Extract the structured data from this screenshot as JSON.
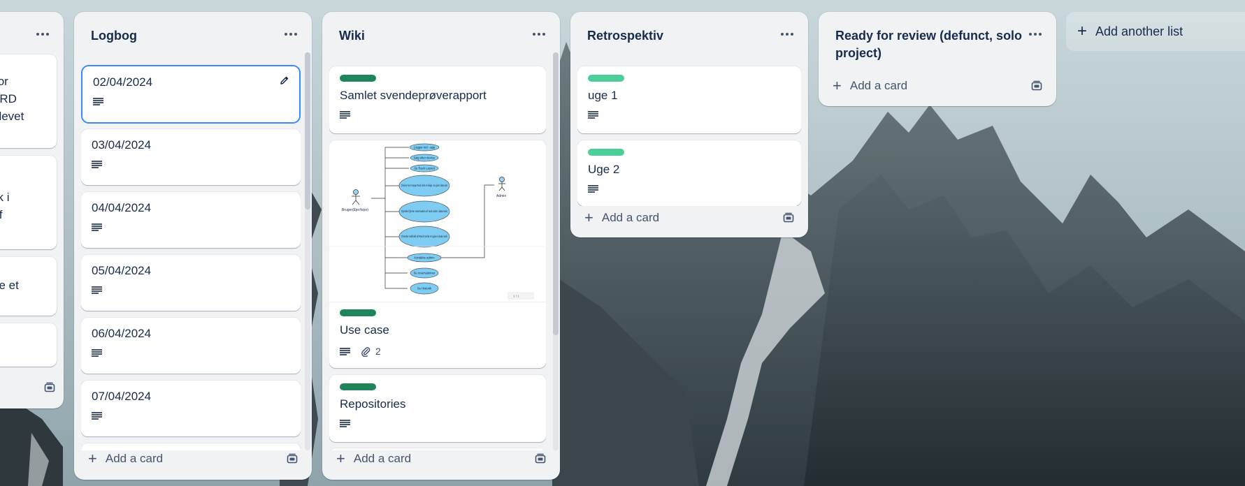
{
  "lists": {
    "partial": {
      "card_texts": [
        [
          "for",
          "ERD",
          "blevet"
        ],
        [
          "",
          "ck i",
          "if"
        ],
        [
          "tte et"
        ]
      ]
    },
    "logbog": {
      "title": "Logbog",
      "cards": [
        "02/04/2024",
        "03/04/2024",
        "04/04/2024",
        "05/04/2024",
        "06/04/2024",
        "07/04/2024"
      ],
      "add_card_label": "Add a card"
    },
    "wiki": {
      "title": "Wiki",
      "cards": {
        "samlet": {
          "title": "Samlet svendeprøverapport",
          "label_color": "#1f845a"
        },
        "usecase": {
          "title": "Use case",
          "label_color": "#1f845a",
          "attachments": "2",
          "diagram": {
            "actor_left": "Bruger(Ejer/lejer)",
            "actor_right": "Admin",
            "use_cases": [
              "Logger ind - app",
              "Søg efter device",
              "Se Rack Layout",
              "Checke hvor mange Rack Units er ledige i en given data rack",
              "Oprette/ fjerne reservation af rack units i data rack",
              "Checke indhold af Rack Units en given data rack",
              "Kontakte admin",
              "Se reservationer",
              "Se Historik"
            ],
            "page_indicator": "1 / 1"
          }
        },
        "repos": {
          "title": "Repositories",
          "label_color": "#1f845a"
        }
      },
      "add_card_label": "Add a card"
    },
    "retro": {
      "title": "Retrospektiv",
      "cards": [
        {
          "title": "uge 1",
          "label_color": "#4bce97"
        },
        {
          "title": "Uge 2",
          "label_color": "#4bce97"
        }
      ],
      "add_card_label": "Add a card"
    },
    "ready": {
      "title_line1": "Ready for review (defunct, solo",
      "title_line2": "project)",
      "add_card_label": "Add a card"
    }
  },
  "add_list_label": "Add another list",
  "colors": {
    "list_bg": "#f1f2f4",
    "focus_ring": "#388bff",
    "label_green_dark": "#1f845a",
    "label_green_light": "#4bce97"
  }
}
